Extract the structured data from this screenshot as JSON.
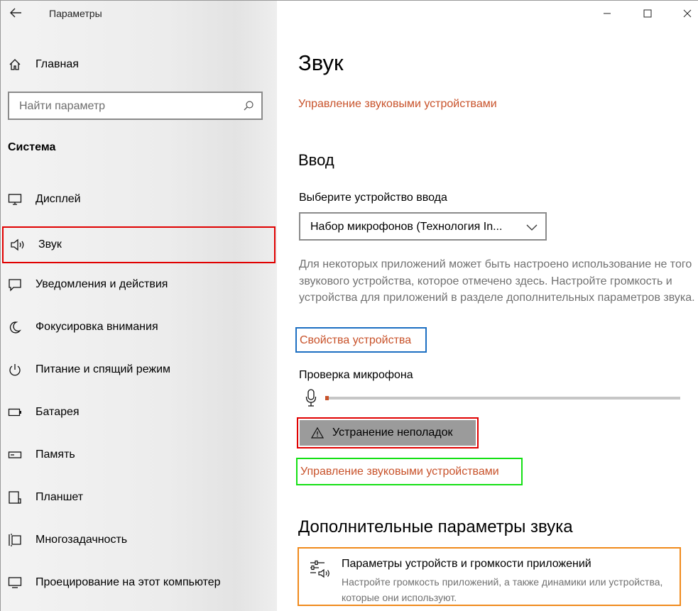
{
  "window": {
    "title": "Параметры"
  },
  "sidebar": {
    "home_label": "Главная",
    "search_placeholder": "Найти параметр",
    "section_title": "Система",
    "items": [
      {
        "label": "Дисплей",
        "icon": "monitor-icon"
      },
      {
        "label": "Звук",
        "icon": "speaker-icon",
        "selected": true
      },
      {
        "label": "Уведомления и действия",
        "icon": "notification-icon"
      },
      {
        "label": "Фокусировка внимания",
        "icon": "moon-icon"
      },
      {
        "label": "Питание и спящий режим",
        "icon": "power-icon"
      },
      {
        "label": "Батарея",
        "icon": "battery-icon"
      },
      {
        "label": "Память",
        "icon": "storage-icon"
      },
      {
        "label": "Планшет",
        "icon": "tablet-icon"
      },
      {
        "label": "Многозадачность",
        "icon": "multitasking-icon"
      },
      {
        "label": "Проецирование на этот компьютер",
        "icon": "projecting-icon"
      }
    ]
  },
  "main": {
    "title": "Звук",
    "top_link": "Управление звуковыми устройствами",
    "input_heading": "Ввод",
    "input_device_label": "Выберите устройство ввода",
    "input_device_value": "Набор микрофонов (Технология In...",
    "description": "Для некоторых приложений может быть настроено использование не того звукового устройства, которое отмечено здесь. Настройте громкость и устройства для приложений в разделе дополнительных параметров звука.",
    "device_properties_link": "Свойства устройства",
    "mic_test_label": "Проверка микрофона",
    "mic_level": 0.01,
    "troubleshoot_label": "Устранение неполадок",
    "manage_devices_link": "Управление звуковыми устройствами",
    "advanced_heading": "Дополнительные параметры звука",
    "app_volume": {
      "title": "Параметры устройств и громкости приложений",
      "subtitle": "Настройте громкость приложений, а также динамики или устройства, которые они используют."
    }
  },
  "colors": {
    "link": "#c8522a",
    "highlight_red": "#e00000",
    "highlight_blue": "#1c6fc2",
    "highlight_green": "#14e014",
    "highlight_orange": "#f08a1c"
  }
}
